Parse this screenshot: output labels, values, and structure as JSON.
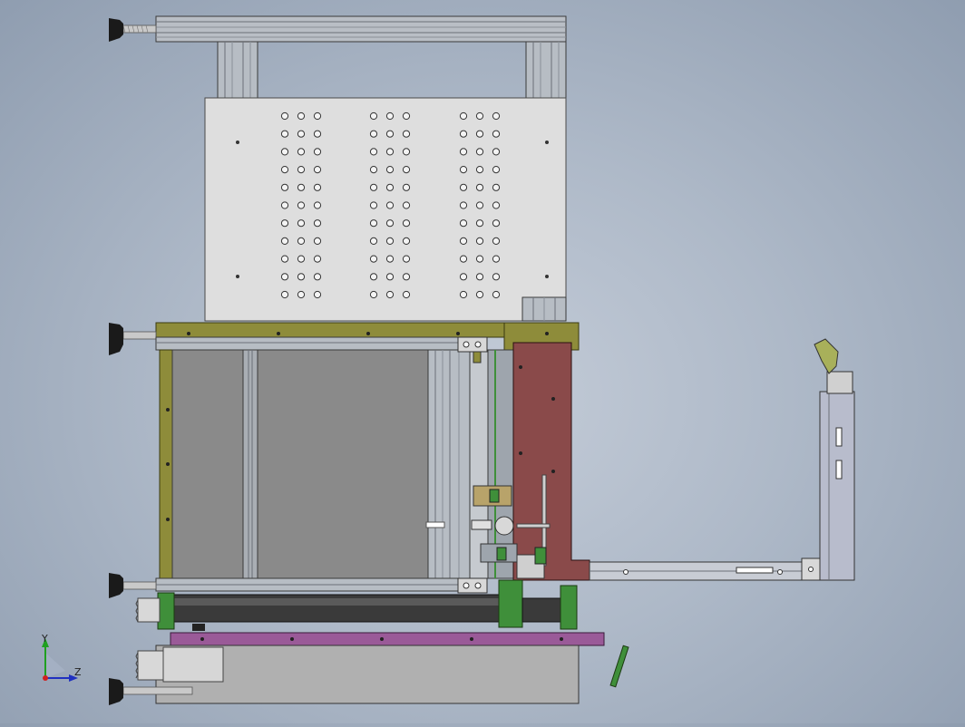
{
  "model_view": {
    "triad": {
      "y_label": "Y",
      "z_label": "Z"
    },
    "colors": {
      "background_center": "#c4ccd8",
      "background_edge": "#8f9db0",
      "aluminum": "#b7bdc4",
      "steel_plate": "#dcdcdc",
      "frame_olive": "#8e8c3a",
      "plate_brown": "#8a4a4a",
      "bar_purple": "#9a5a98",
      "part_green": "#3f8f3a",
      "inner_gray": "#8a8a8a",
      "knob_black": "#1a1a1a"
    }
  }
}
